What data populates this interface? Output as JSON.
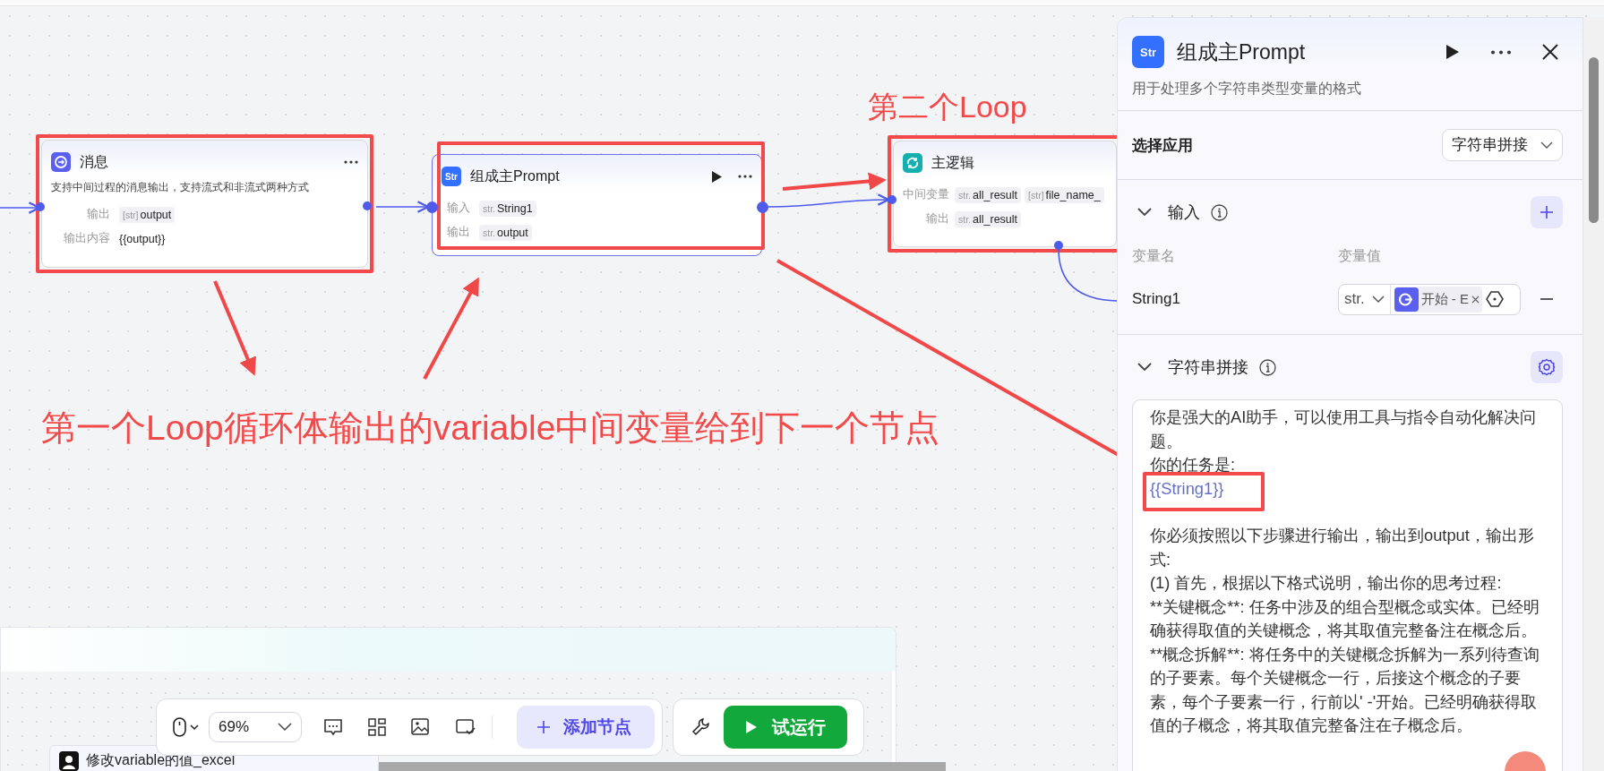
{
  "nodes": [
    {
      "kind": "message",
      "title": "消息",
      "selected": false,
      "highlighted": true,
      "description": "支持中间过程的消息输出，支持流式和非流式两种方式",
      "fields": [
        {
          "label": "输出",
          "tags": [
            {
              "type": "[str]",
              "name": "output"
            }
          ]
        },
        {
          "label": "输出内容",
          "value": "{{output}}"
        }
      ]
    },
    {
      "kind": "string",
      "icon_label": "Str",
      "title": "组成主Prompt",
      "selected": true,
      "highlighted": true,
      "fields": [
        {
          "label": "输入",
          "tags": [
            {
              "type": "str.",
              "name": "String1"
            }
          ]
        },
        {
          "label": "输出",
          "tags": [
            {
              "type": "str.",
              "name": "output"
            }
          ]
        }
      ]
    },
    {
      "kind": "loop",
      "title": "主逻辑",
      "selected": false,
      "highlighted": true,
      "fields": [
        {
          "label": "中间变量",
          "tags": [
            {
              "type": "str.",
              "name": "all_result"
            },
            {
              "type": "[str]",
              "name": "file_name_"
            }
          ]
        },
        {
          "label": "输出",
          "tags": [
            {
              "type": "str.",
              "name": "all_result"
            }
          ]
        }
      ]
    }
  ],
  "annotations": [
    {
      "kind": "small",
      "text": "第二个Loop"
    },
    {
      "kind": "large",
      "text": "第一个Loop循环体输出的variable中间变量给到下一个节点"
    }
  ],
  "panel": {
    "icon_label": "Str",
    "title": "组成主Prompt",
    "subtitle": "用于处理多个字符串类型变量的格式",
    "app_label": "选择应用",
    "app_value": "字符串拼接",
    "input_section": {
      "title": "输入",
      "expanded": true,
      "name_header": "变量名",
      "value_header": "变量值",
      "rows": [
        {
          "name": "String1",
          "type": "str.",
          "source": "开始 - E"
        }
      ]
    },
    "template_section": {
      "title": "字符串拼接",
      "expanded": true,
      "blocks": [
        {
          "kind": "text",
          "text": "你是强大的AI助手，可以使用工具与指令自动化解决问题。"
        },
        {
          "kind": "text",
          "text": "你的任务是:"
        },
        {
          "kind": "variable",
          "text": "{{String1}}",
          "highlighted": true
        },
        {
          "kind": "text",
          "text": "你必须按照以下步骤进行输出，输出到output，输出形式:",
          "spaced": true
        },
        {
          "kind": "text",
          "text": "(1) 首先，根据以下格式说明，输出你的思考过程:"
        },
        {
          "kind": "text",
          "text": "**关键概念**: 任务中涉及的组合型概念或实体。已经明确获得取值的关键概念，将其取值完整备注在概念后。"
        },
        {
          "kind": "text",
          "text": "**概念拆解**: 将任务中的关键概念拆解为一系列待查询的子要素。每个关键概念一行，后接这个概念的子要素，每个子要素一行，行前以' -'开始。已经明确获得取值的子概念，将其取值完整备注在子概念后。"
        }
      ]
    }
  },
  "toolbar": {
    "zoom": "69%",
    "add_node": "添加节点",
    "run": "试运行"
  },
  "bottom_node": {
    "title": "修改variable的值_excel"
  }
}
